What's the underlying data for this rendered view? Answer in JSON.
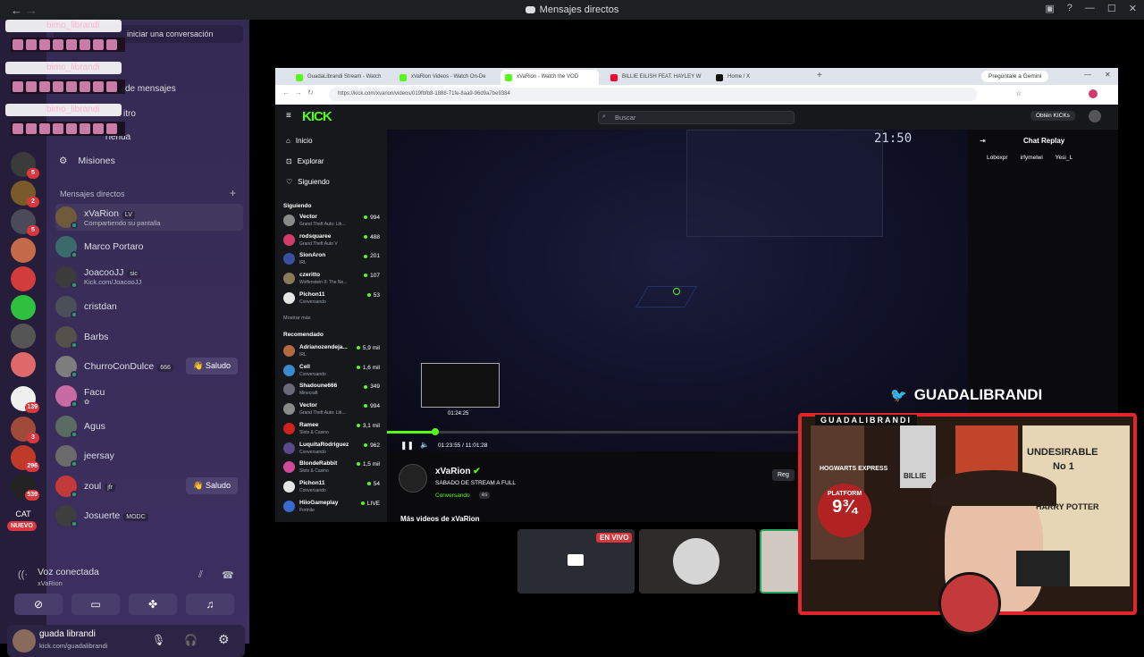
{
  "discord": {
    "window_title": "Mensajes directos",
    "back_glyph": "←",
    "forward_glyph": "→",
    "inbox_glyph": "▣",
    "help_glyph": "?",
    "min_glyph": "—",
    "max_glyph": "☐",
    "close_glyph": "✕",
    "start_conversation": "iniciar una conversación",
    "requests_label": "de mensajes",
    "nitro_label": "itro",
    "home_label": "Tienda",
    "missions_label": "Misiones",
    "dm_header": "Mensajes directos",
    "add_dm": "+",
    "dms": [
      {
        "name": "xVaRion",
        "tag": "LV",
        "sub": "Compartiendo su pantalla",
        "color": "#6f5a3c"
      },
      {
        "name": "Marco Portaro",
        "tag": "",
        "sub": "",
        "color": "#3a6a6a"
      },
      {
        "name": "JoacooJJ",
        "tag": "sic",
        "sub": "Kick.com/JoacooJJ",
        "color": "#3b3b3b"
      },
      {
        "name": "cristdan",
        "tag": "",
        "sub": "",
        "color": "#4b4f57"
      },
      {
        "name": "Barbs",
        "tag": "",
        "sub": "",
        "color": "#55504a"
      },
      {
        "name": "ChurroConDulce",
        "tag": "666",
        "sub": "",
        "color": "#7d7d7d"
      },
      {
        "name": "Facu",
        "tag": "",
        "sub": "✿",
        "color": "#c86aa4"
      },
      {
        "name": "Agus",
        "tag": "",
        "sub": "",
        "color": "#5a6b61"
      },
      {
        "name": "jeersay",
        "tag": "",
        "sub": "",
        "color": "#6b6b6b"
      },
      {
        "name": "zoul",
        "tag": "jfr",
        "sub": "",
        "color": "#c33a3a"
      },
      {
        "name": "Josuerte",
        "tag": "MODC",
        "sub": "",
        "color": "#3e3e3e"
      }
    ],
    "saludo_label": "👋 Saludo",
    "server_badges": [
      "5",
      "2",
      "5",
      "139",
      "3",
      "296",
      "539"
    ],
    "cat_label": "CAT",
    "nuevo_label": "NUEVO",
    "voice": {
      "status": "Voz conectada",
      "channel": "xVaRion"
    },
    "user": {
      "name": "guada librandi",
      "status": "kick.com/guadalibrandi"
    },
    "overlay_chat_name": "bimo_librandi"
  },
  "browser": {
    "tabs": [
      {
        "title": "GuadaLibrandi Stream - Watch",
        "color": "#53fc18"
      },
      {
        "title": "xVaRion Videos - Watch On-De",
        "color": "#53fc18"
      },
      {
        "title": "xVaRion - Watch the VOD",
        "color": "#53fc18"
      },
      {
        "title": "BILLIE EILISH FEAT. HAYLEY W",
        "color": "#ff0033"
      },
      {
        "title": "Home / X",
        "color": "#111111"
      }
    ],
    "gemini_label": "Pregúntale a Gemini",
    "url": "https://kick.com/xvarion/videos/019fbfb8-1888-71fe-8aa9-96d9a7be9384"
  },
  "kick": {
    "logo": "KICK",
    "search_placeholder": "Buscar",
    "obtain_label": "Obtén KICKs",
    "nav": [
      "Inicio",
      "Explorar",
      "Siguiendo"
    ],
    "following_header": "Siguiendo",
    "following": [
      {
        "name": "Vector",
        "game": "Grand Theft Auto: Lib...",
        "viewers": "994",
        "color": "#8a8a8a"
      },
      {
        "name": "rodsquaree",
        "game": "Grand Theft Auto V",
        "viewers": "488",
        "color": "#d23c6a"
      },
      {
        "name": "SionAron",
        "game": "IRL",
        "viewers": "201",
        "color": "#3a4fa0"
      },
      {
        "name": "czeritto",
        "game": "Wolfenstein II: The Ne...",
        "viewers": "107",
        "color": "#8a7a5a"
      },
      {
        "name": "Pichon11",
        "game": "Conversando",
        "viewers": "53",
        "color": "#e6e6e6"
      }
    ],
    "show_more": "Mostrar más",
    "recommended_header": "Recomendado",
    "recommended": [
      {
        "name": "Adrianozendeja...",
        "game": "IRL",
        "viewers": "5,9 mil",
        "color": "#b36a40"
      },
      {
        "name": "Cell",
        "game": "Conversando",
        "viewers": "1,6 mil",
        "color": "#3a8ad0"
      },
      {
        "name": "Shadoune666",
        "game": "Minecraft",
        "viewers": "349",
        "color": "#6a6a7a"
      },
      {
        "name": "Vector",
        "game": "Grand Theft Auto: Lib...",
        "viewers": "994",
        "color": "#8a8a8a"
      },
      {
        "name": "Ramee",
        "game": "Slots & Casino",
        "viewers": "3,1 mil",
        "color": "#d02020"
      },
      {
        "name": "LuquitaRodriguez",
        "game": "Conversando",
        "viewers": "962",
        "color": "#5a4a8a"
      },
      {
        "name": "BlondeRabbit",
        "game": "Slots & Casino",
        "viewers": "1,5 mil",
        "color": "#d04a9a"
      },
      {
        "name": "Pichon11",
        "game": "Conversando",
        "viewers": "54",
        "color": "#e6e6e6"
      },
      {
        "name": "HiioGameplay",
        "game": "Fortnite",
        "viewers": "LIVE",
        "color": "#3a6ad0"
      }
    ],
    "chat_replay": "Chat Replay",
    "chat_users": [
      "Loboxpr",
      "irfymelwi",
      "Yesi_L"
    ],
    "preview_time": "01:24:25",
    "time_display": "01:23:55 / 11:01:28",
    "progress": 0.127,
    "video_clock": "21:50",
    "streamer_name": "xVaRion",
    "stream_title": "SABADO DE STREAM A FULL",
    "stream_category": "Conversando",
    "stream_lang": "es",
    "more_videos": "Más videos de xVaRion",
    "reg_label": "Reg"
  },
  "stream_overlay": {
    "twitter_handle": "GUADALIBRANDI",
    "cam_title": "GUADALIBRANDI",
    "live_badge": "EN VIVO",
    "poster_undesirable": "UNDESIRABLE",
    "poster_no1": "No 1",
    "poster_harry": "HARRY POTTER",
    "platform_label": "PLATFORM",
    "platform_number": "9¾",
    "hogwarts": "HOGWARTS EXPRESS",
    "billie": "BILLIE"
  }
}
